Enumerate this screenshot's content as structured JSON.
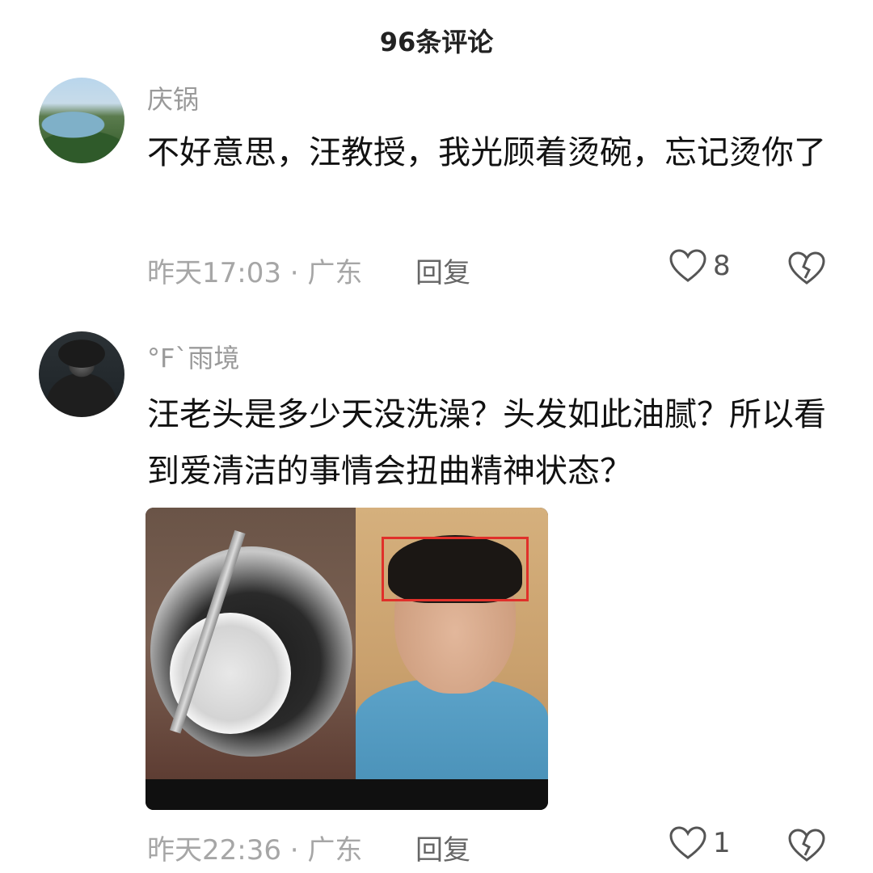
{
  "header": {
    "title": "96条评论"
  },
  "comments": [
    {
      "username": "庆锅",
      "text": "不好意思，汪教授，我光顾着烫碗，忘记烫你了",
      "time_location": "昨天17:03 · 广东",
      "reply_label": "回复",
      "likes": "8"
    },
    {
      "username": "°F`雨境",
      "text": "汪老头是多少天没洗澡？头发如此油腻？所以看到爱清洁的事情会扭曲精神状态？",
      "time_location": "昨天22:36 · 广东",
      "reply_label": "回复",
      "likes": "1"
    }
  ],
  "icons": {
    "like": "heart-outline-icon",
    "dislike": "broken-heart-icon"
  },
  "colors": {
    "meta": "#a6a6a6",
    "highlight_box": "#e0302a"
  }
}
